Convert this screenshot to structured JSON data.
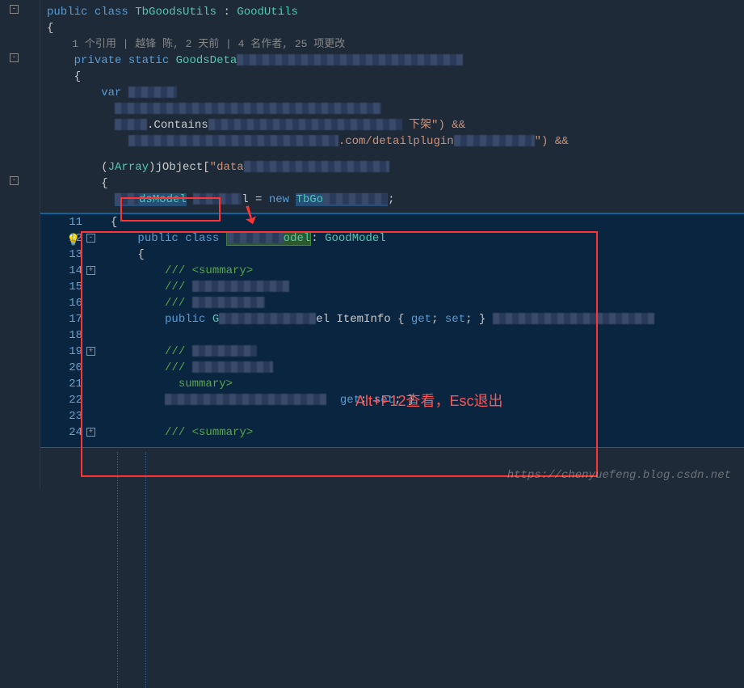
{
  "upper": {
    "l1_public": "public",
    "l1_class": "class",
    "l1_name": "TbGoodsUtils",
    "l1_colon": " : ",
    "l1_base": "GoodUtils",
    "l2_brace": "{",
    "codelens": "1 个引用 | 越锋 陈, 2 天前 | 4 名作者, 25 项更改",
    "l3_private": "private",
    "l3_static": "static",
    "l3_type": "GoodsDeta",
    "l4_brace": "{",
    "l5_var": "var",
    "l6_contains": ".Contains",
    "l6_tail": "下架\") &&",
    "l7_mid": ".com/detailplugin",
    "l7_tail": "\") &&",
    "l8_jarray": "(JArray)jObject[\"data",
    "l9_brace": "{",
    "l10_model": "dsModel",
    "l10_eq": "l = ",
    "l10_new": "new",
    "l10_tbgo": "TbGo"
  },
  "peek": {
    "ln11": "11",
    "ln12": "12",
    "ln13": "13",
    "ln14": "14",
    "ln15": "15",
    "ln16": "16",
    "ln17": "17",
    "ln18": "18",
    "ln19": "19",
    "ln20": "20",
    "ln21": "21",
    "ln22": "22",
    "ln23": "23",
    "ln24": "24",
    "p11": "{",
    "p12_public": "public",
    "p12_class": "class",
    "p12_model": "odel",
    "p12_colon": ": ",
    "p12_base": "GoodModel",
    "p13": "{",
    "p14": "/// <summary>",
    "p15": "///",
    "p16": "///",
    "p17_public": "public",
    "p17_g": "G",
    "p17_item": "el ItemInfo { ",
    "p17_get": "get",
    "p17_set": "set",
    "p17_end": "; }",
    "p19": "///",
    "p20": "///",
    "p21": "summary>",
    "p22_get": "get",
    "p22_set": "set",
    "p22_end": "; }",
    "p24": "/// <summary>"
  },
  "annotation": "Alt+F12查看，Esc退出",
  "watermark": "https://chenyuefeng.blog.csdn.net"
}
